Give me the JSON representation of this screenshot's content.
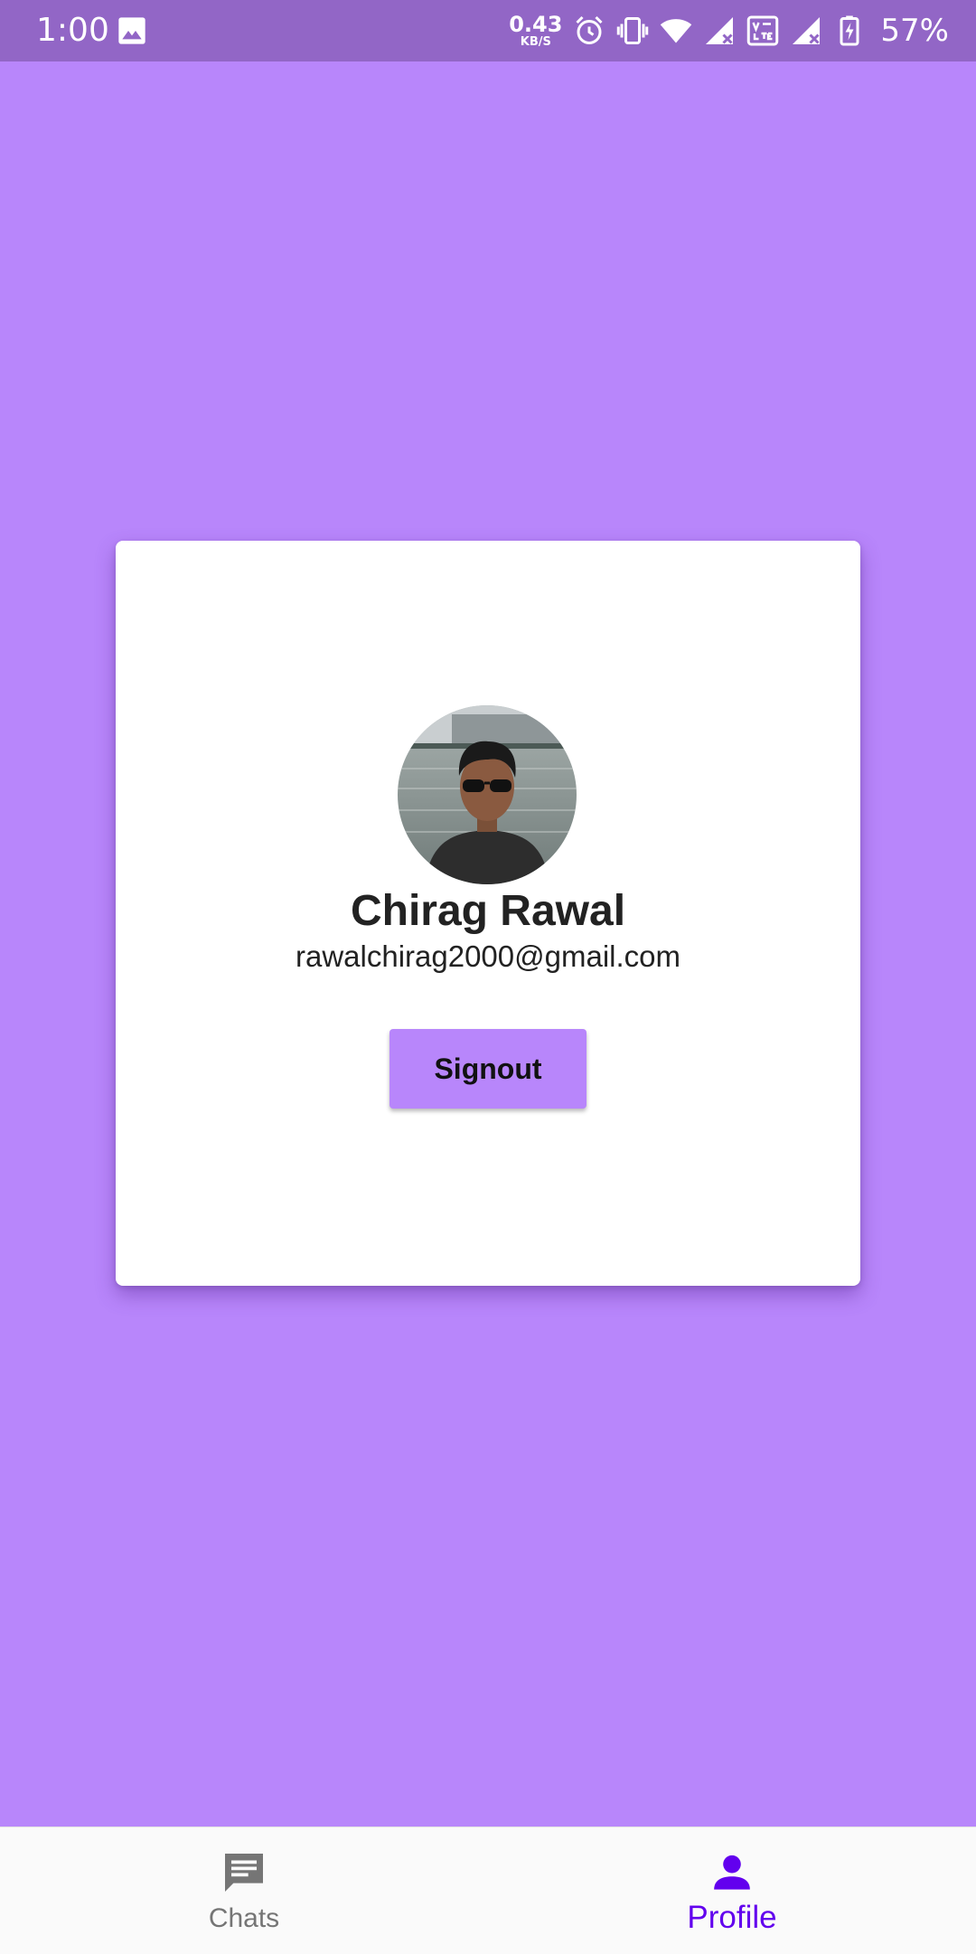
{
  "status_bar": {
    "time": "1:00",
    "net_speed_value": "0.43",
    "net_speed_unit": "KB/S",
    "battery_percent": "57%",
    "icons": [
      "gallery-icon",
      "alarm-icon",
      "vibrate-icon",
      "wifi-icon",
      "cell-signal-icon",
      "volte-icon",
      "cell-signal-icon",
      "battery-charging-icon"
    ]
  },
  "profile": {
    "name": "Chirag Rawal",
    "email": "rawalchirag2000@gmail.com",
    "signout_label": "Signout"
  },
  "bottom_nav": {
    "items": [
      {
        "label": "Chats",
        "icon": "chat-icon",
        "active": false
      },
      {
        "label": "Profile",
        "icon": "person-icon",
        "active": true
      }
    ]
  },
  "colors": {
    "background": "#b886fb",
    "status_bar": "#9266c6",
    "active_nav": "#6200ee",
    "inactive_nav": "#757575",
    "card": "#ffffff"
  }
}
